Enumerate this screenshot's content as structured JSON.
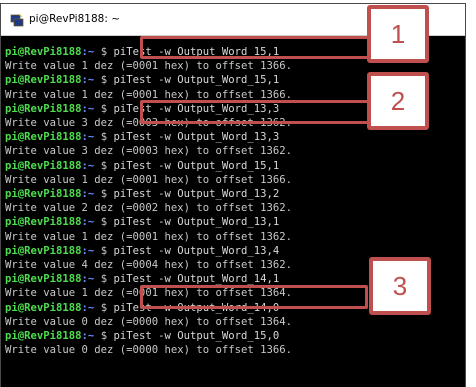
{
  "window": {
    "title": "pi@RevPi8188: ~",
    "icon": "putty-terminal-icon"
  },
  "outside_text": "bi",
  "colors": {
    "prompt_user": "#4fdc4f",
    "prompt_path": "#6a8cff",
    "text": "#c8c8c8",
    "annotation": "#c0504d",
    "background": "#000000"
  },
  "terminal": {
    "lines": [
      {
        "type": "prompt",
        "user": "pi@RevPi8188",
        "path": ":~",
        "sym": " $ ",
        "cmd": "piTest -w Output_Word_15,1"
      },
      {
        "type": "output",
        "text": "Write value 1 dez (=0001 hex) to offset 1366."
      },
      {
        "type": "prompt",
        "user": "pi@RevPi8188",
        "path": ":~",
        "sym": " $ ",
        "cmd": "piTest -w Output_Word_15,1"
      },
      {
        "type": "output",
        "text": "Write value 1 dez (=0001 hex) to offset 1366."
      },
      {
        "type": "prompt",
        "user": "pi@RevPi8188",
        "path": ":~",
        "sym": " $ ",
        "cmd": "piTest -w Output_Word_13,3"
      },
      {
        "type": "output",
        "text": "Write value 3 dez (=0003 hex) to offset 1362."
      },
      {
        "type": "prompt",
        "user": "pi@RevPi8188",
        "path": ":~",
        "sym": " $ ",
        "cmd": "piTest -w Output_Word_13,3"
      },
      {
        "type": "output",
        "text": "Write value 3 dez (=0003 hex) to offset 1362."
      },
      {
        "type": "prompt",
        "user": "pi@RevPi8188",
        "path": ":~",
        "sym": " $ ",
        "cmd": "piTest -w Output_Word_15,1"
      },
      {
        "type": "output",
        "text": "Write value 1 dez (=0001 hex) to offset 1366."
      },
      {
        "type": "prompt",
        "user": "pi@RevPi8188",
        "path": ":~",
        "sym": " $ ",
        "cmd": "piTest -w Output_Word_13,2"
      },
      {
        "type": "output",
        "text": "Write value 2 dez (=0002 hex) to offset 1362."
      },
      {
        "type": "prompt",
        "user": "pi@RevPi8188",
        "path": ":~",
        "sym": " $ ",
        "cmd": "piTest -w Output_Word_13,1"
      },
      {
        "type": "output",
        "text": "Write value 1 dez (=0001 hex) to offset 1362."
      },
      {
        "type": "prompt",
        "user": "pi@RevPi8188",
        "path": ":~",
        "sym": " $ ",
        "cmd": "piTest -w Output_Word_13,4"
      },
      {
        "type": "output",
        "text": "Write value 4 dez (=0004 hex) to offset 1362."
      },
      {
        "type": "prompt",
        "user": "pi@RevPi8188",
        "path": ":~",
        "sym": " $ ",
        "cmd": "piTest -w Output_Word_14,1"
      },
      {
        "type": "output",
        "text": "Write value 1 dez (=0001 hex) to offset 1364."
      },
      {
        "type": "prompt",
        "user": "pi@RevPi8188",
        "path": ":~",
        "sym": " $ ",
        "cmd": "piTest -w Output_Word_14,0"
      },
      {
        "type": "output",
        "text": "Write value 0 dez (=0000 hex) to offset 1364."
      },
      {
        "type": "prompt",
        "user": "pi@RevPi8188",
        "path": ":~",
        "sym": " $ ",
        "cmd": "piTest -w Output_Word_15,0"
      },
      {
        "type": "output",
        "text": "Write value 0 dez (=0000 hex) to offset 1366."
      }
    ]
  },
  "annotations": [
    {
      "number": "1",
      "highlights_line": 0
    },
    {
      "number": "2",
      "highlights_line": 4
    },
    {
      "number": "3",
      "highlights_line": 16
    }
  ]
}
